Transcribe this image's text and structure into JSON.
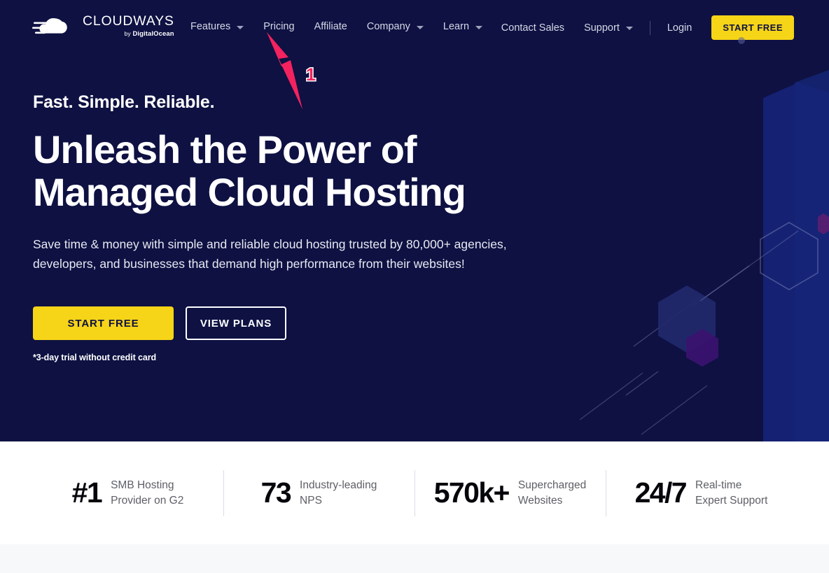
{
  "brand": {
    "logo_name": "CLOUDWAYS",
    "logo_by": "by",
    "logo_parent": "DigitalOcean",
    "logo_icon": "cloud-speed-icon",
    "navy": "#0e1142",
    "yellow": "#f6d417",
    "accent_pink": "#f4225f"
  },
  "header": {
    "nav_main": [
      {
        "label": "Features",
        "has_dropdown": true
      },
      {
        "label": "Pricing",
        "has_dropdown": false
      },
      {
        "label": "Affiliate",
        "has_dropdown": false
      },
      {
        "label": "Company",
        "has_dropdown": true
      },
      {
        "label": "Learn",
        "has_dropdown": true
      }
    ],
    "nav_right": [
      {
        "label": "Contact Sales",
        "has_dropdown": false
      },
      {
        "label": "Support",
        "has_dropdown": true
      }
    ],
    "login_label": "Login",
    "cta_label": "START FREE"
  },
  "hero": {
    "eyebrow": "Fast. Simple. Reliable.",
    "headline": "Unleash the Power of Managed Cloud Hosting",
    "subtitle": "Save time & money with simple and reliable cloud hosting trusted by 80,000+ agencies, developers, and businesses that demand high performance from their websites!",
    "primary_cta": "START FREE",
    "secondary_cta": "VIEW PLANS",
    "trial_note": "*3-day trial without credit card"
  },
  "annotation": {
    "number": "1",
    "target": "Pricing",
    "arrow_color": "#f4225f"
  },
  "stats": [
    {
      "value": "#1",
      "label": "SMB Hosting\nProvider on G2"
    },
    {
      "value": "73",
      "label": "Industry-leading\nNPS"
    },
    {
      "value": "570k+",
      "label": "Supercharged\nWebsites"
    },
    {
      "value": "24/7",
      "label": "Real-time\nExpert Support"
    }
  ]
}
